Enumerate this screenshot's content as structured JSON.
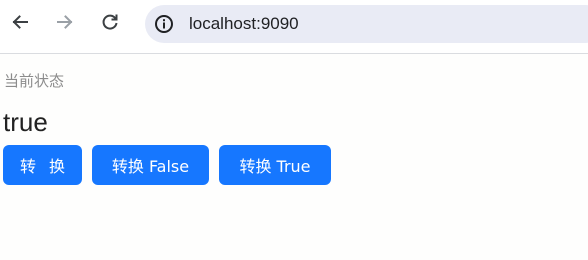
{
  "browser": {
    "url": "localhost:9090",
    "icons": {
      "back": "arrow-left-icon",
      "forward": "arrow-right-icon",
      "reload": "reload-icon",
      "site_info": "info-circle-icon"
    }
  },
  "page": {
    "status_label": "当前状态",
    "status_value": "true",
    "buttons": {
      "toggle": "转 换",
      "set_false": "转换 False",
      "set_true": "转换 True"
    }
  },
  "colors": {
    "primary_button": "#1677ff",
    "omnibox_bg": "#e9ebf5",
    "page_bg": "#fefefd"
  }
}
